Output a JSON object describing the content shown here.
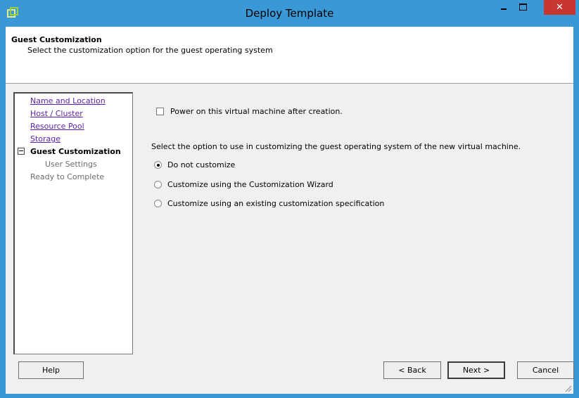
{
  "window": {
    "title": "Deploy Template",
    "close_glyph": "✕"
  },
  "header": {
    "title": "Guest Customization",
    "subtitle": "Select the customization option for the guest operating system"
  },
  "nav": {
    "items": [
      {
        "label": "Name and Location",
        "state": "link"
      },
      {
        "label": "Host / Cluster",
        "state": "link"
      },
      {
        "label": "Resource Pool",
        "state": "link"
      },
      {
        "label": "Storage",
        "state": "link"
      },
      {
        "label": "Guest Customization",
        "state": "current"
      },
      {
        "label": "User Settings",
        "state": "disabled"
      },
      {
        "label": "Ready to Complete",
        "state": "disabled"
      }
    ]
  },
  "content": {
    "power_on_label": "Power on this virtual machine after creation.",
    "power_on_checked": false,
    "instruction": "Select the option to use in customizing the guest operating system of the new virtual machine.",
    "options": [
      {
        "label": "Do not customize",
        "checked": true
      },
      {
        "label": "Customize using the Customization Wizard",
        "checked": false
      },
      {
        "label": "Customize using an existing customization specification",
        "checked": false
      }
    ]
  },
  "buttons": {
    "help": "Help",
    "back": "< Back",
    "next": "Next >",
    "cancel": "Cancel"
  },
  "colors": {
    "titlebar": "#3a98d6",
    "close": "#c7372f",
    "link": "#5a1fb0"
  }
}
